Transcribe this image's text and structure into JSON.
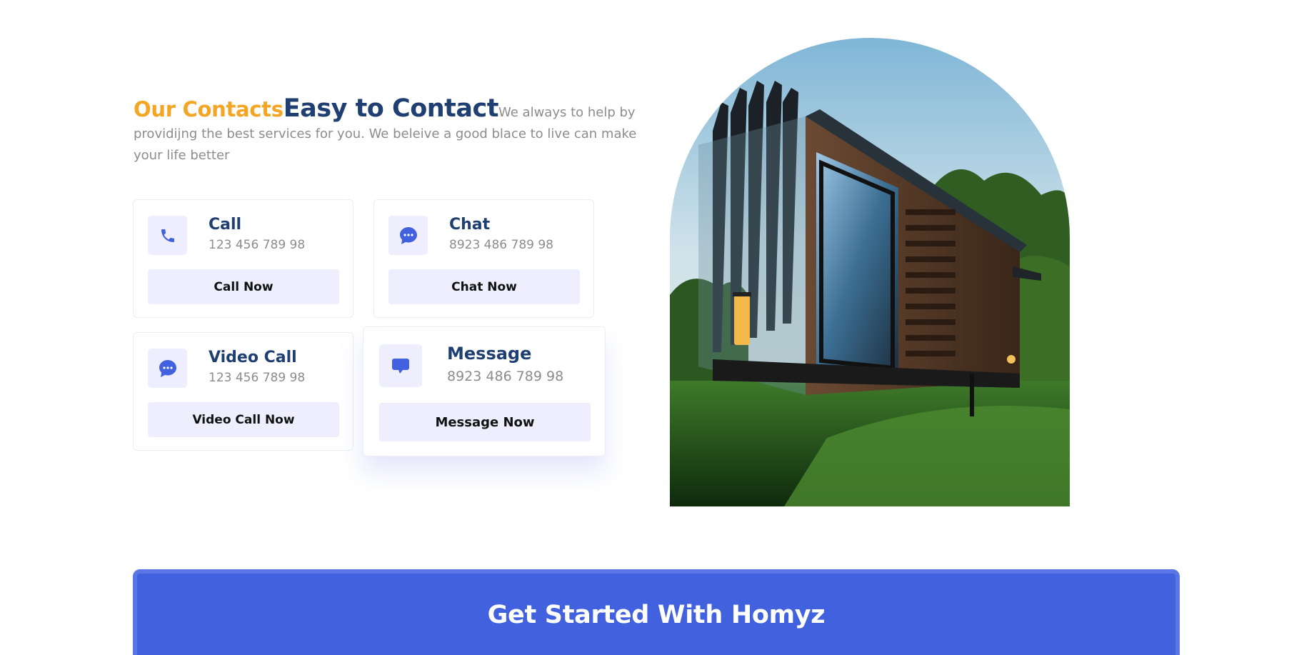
{
  "contact": {
    "orange_title": "Our Contacts",
    "primary_title": "Easy to Contact",
    "description": "We always to help by providijng the best services for you. We beleive a good blace to live can make your life better"
  },
  "cards": [
    {
      "icon": "phone-icon",
      "title": "Call",
      "detail": "123 456 789 98",
      "button": "Call Now"
    },
    {
      "icon": "chat-icon",
      "title": "Chat",
      "detail": "8923 486 789 98",
      "button": "Chat Now"
    },
    {
      "icon": "chat-icon",
      "title": "Video Call",
      "detail": "123 456 789 98",
      "button": "Video Call Now"
    },
    {
      "icon": "message-icon",
      "title": "Message",
      "detail": "8923 486 789 98",
      "button": "Message Now"
    }
  ],
  "banner": {
    "title": "Get Started With Homyz"
  },
  "colors": {
    "orange": "#f5a524",
    "primary": "#1f3e72",
    "accent": "#4161df",
    "icon_bg": "#eeeeff"
  }
}
